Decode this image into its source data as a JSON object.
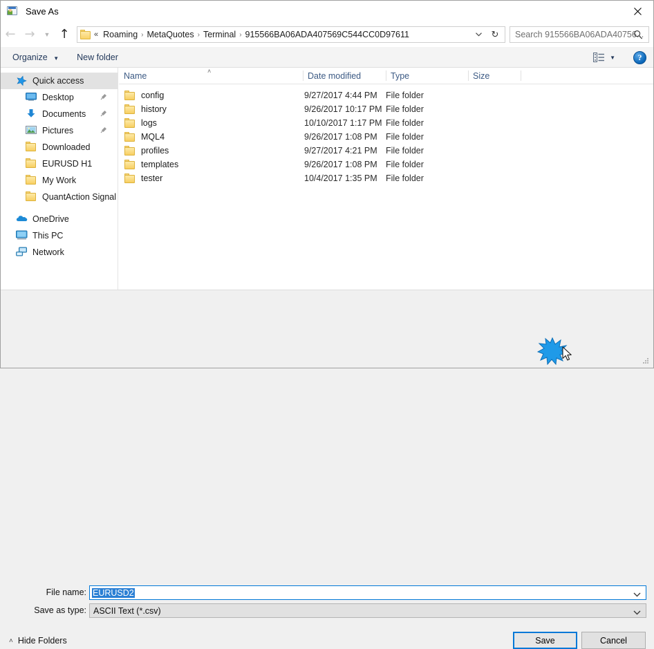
{
  "window": {
    "title": "Save As",
    "icon": "save-as-icon",
    "close_label": "✕"
  },
  "nav": {
    "back": "←",
    "forward": "→",
    "recent": "⌄",
    "up": "↑",
    "overflow": "«",
    "refresh": "↻",
    "breadcrumbs": [
      "Roaming",
      "MetaQuotes",
      "Terminal",
      "915566BA06ADA407569C544CC0D97611"
    ],
    "separator": "›"
  },
  "search": {
    "placeholder": "Search 915566BA06ADA40756...",
    "icon": "search-icon"
  },
  "toolbar": {
    "organize": "Organize",
    "organize_caret": "▾",
    "new_folder": "New folder",
    "view_caret": "▾",
    "help": "?"
  },
  "sidebar": {
    "items": [
      {
        "label": "Quick access",
        "icon": "star-icon",
        "indent": 1,
        "selected": true,
        "pinned": false
      },
      {
        "label": "Desktop",
        "icon": "desktop-icon",
        "indent": 2,
        "selected": false,
        "pinned": true
      },
      {
        "label": "Documents",
        "icon": "documents-icon",
        "indent": 2,
        "selected": false,
        "pinned": true
      },
      {
        "label": "Pictures",
        "icon": "pictures-icon",
        "indent": 2,
        "selected": false,
        "pinned": true
      },
      {
        "label": "Downloaded",
        "icon": "folder-icon",
        "indent": 2,
        "selected": false,
        "pinned": false
      },
      {
        "label": "EURUSD H1",
        "icon": "folder-icon",
        "indent": 2,
        "selected": false,
        "pinned": false
      },
      {
        "label": "My Work",
        "icon": "folder-icon",
        "indent": 2,
        "selected": false,
        "pinned": false
      },
      {
        "label": "QuantAction Signal",
        "icon": "folder-icon",
        "indent": 2,
        "selected": false,
        "pinned": false
      },
      {
        "label": "OneDrive",
        "icon": "onedrive-icon",
        "indent": 1,
        "selected": false,
        "pinned": false
      },
      {
        "label": "This PC",
        "icon": "thispc-icon",
        "indent": 1,
        "selected": false,
        "pinned": false
      },
      {
        "label": "Network",
        "icon": "network-icon",
        "indent": 1,
        "selected": false,
        "pinned": false
      }
    ]
  },
  "filelist": {
    "columns": [
      "Name",
      "Date modified",
      "Type",
      "Size"
    ],
    "sort_caret": "˄",
    "rows": [
      {
        "name": "config",
        "date": "9/27/2017 4:44 PM",
        "type": "File folder",
        "size": ""
      },
      {
        "name": "history",
        "date": "9/26/2017 10:17 PM",
        "type": "File folder",
        "size": ""
      },
      {
        "name": "logs",
        "date": "10/10/2017 1:17 PM",
        "type": "File folder",
        "size": ""
      },
      {
        "name": "MQL4",
        "date": "9/26/2017 1:08 PM",
        "type": "File folder",
        "size": ""
      },
      {
        "name": "profiles",
        "date": "9/27/2017 4:21 PM",
        "type": "File folder",
        "size": ""
      },
      {
        "name": "templates",
        "date": "9/26/2017 1:08 PM",
        "type": "File folder",
        "size": ""
      },
      {
        "name": "tester",
        "date": "10/4/2017 1:35 PM",
        "type": "File folder",
        "size": ""
      }
    ]
  },
  "form": {
    "filename_label": "File name:",
    "filename_value": "EURUSD2",
    "filetype_label": "Save as type:",
    "filetype_value": "ASCII Text (*.csv)",
    "dropdown_icon": "chevron-down-icon"
  },
  "footer": {
    "hide_folders": "Hide Folders",
    "hide_caret": "˄",
    "save": "Save",
    "cancel": "Cancel"
  },
  "colors": {
    "accent": "#0078d7",
    "selection": "#2a7fd4",
    "folder_yellow": "#f8cf62",
    "header_text": "#3c5a84"
  }
}
